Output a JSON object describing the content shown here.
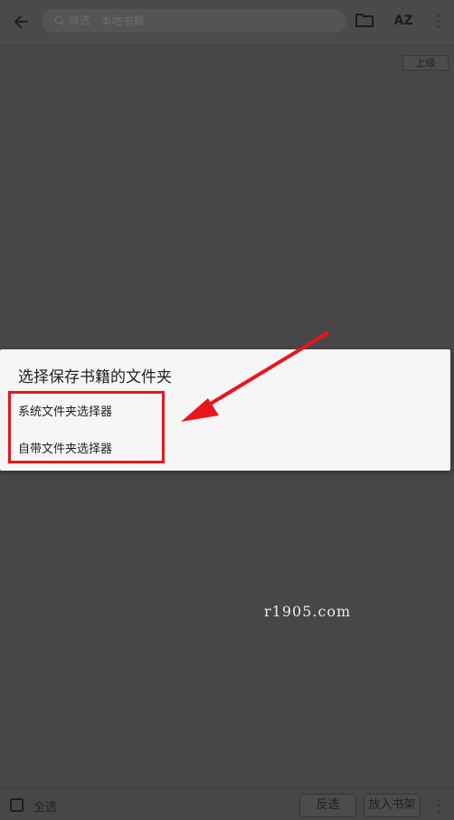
{
  "toolbar": {
    "search_placeholder": "筛选 · 本地书籍",
    "sort_label": "AZ"
  },
  "navigation": {
    "up_label": "上级"
  },
  "dialog": {
    "title": "选择保存书籍的文件夹",
    "options": [
      {
        "label": "系统文件夹选择器"
      },
      {
        "label": "自带文件夹选择器"
      }
    ]
  },
  "annotation": {
    "highlight_color": "#e8161b"
  },
  "watermark": "r1905.com",
  "bottom_bar": {
    "select_all_label": "全选",
    "select_all_checked": false,
    "invert_label": "反选",
    "add_to_shelf_label": "放入书架"
  }
}
